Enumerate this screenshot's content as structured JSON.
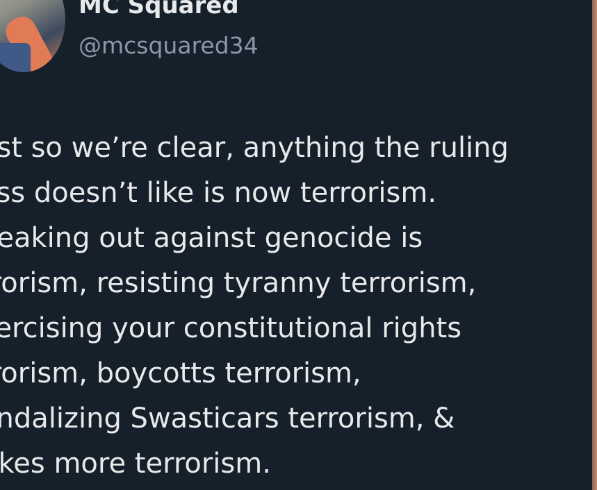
{
  "author": {
    "display_name": "MC Squared",
    "handle": "@mcsquared34"
  },
  "tweet": {
    "lines": [
      "ust so we’re clear, anything the ruling",
      "ass doesn’t like is now terrorism.",
      "peaking out against genocide is",
      "rrorism, resisting tyranny terrorism,",
      "xercising your constitutional rights",
      "rrorism, boycotts terrorism,",
      "andalizing Swasticars terrorism, &",
      "rikes more terrorism."
    ]
  },
  "colors": {
    "background": "#15202b",
    "text": "#e7e9ea",
    "secondary_text": "#8b98a5"
  }
}
